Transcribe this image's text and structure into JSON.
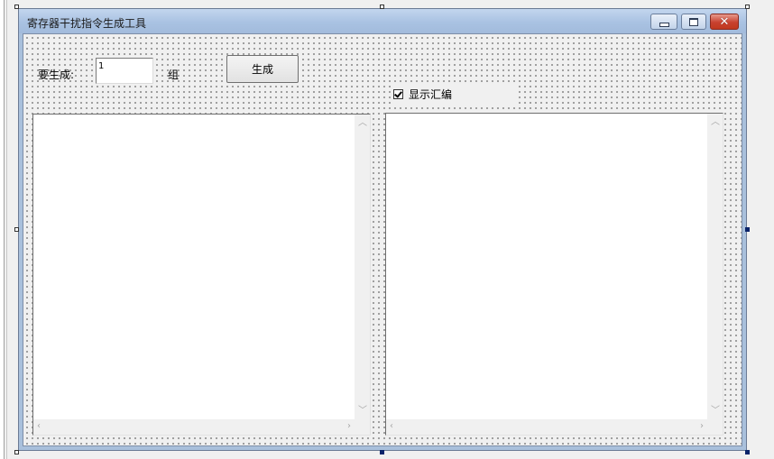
{
  "window": {
    "title": "寄存器干扰指令生成工具"
  },
  "controls": {
    "generate_label": "要生成:",
    "count_value": "1",
    "group_unit": "组",
    "generate_button": "生成",
    "show_asm_label": "显示汇编",
    "show_asm_checked": true
  },
  "icons": {
    "minimize": "minimize-icon",
    "maximize": "maximize-icon",
    "close": "close-icon",
    "scroll_up": "scroll-up-arrow-icon",
    "scroll_down": "scroll-down-arrow-icon",
    "scroll_left": "scroll-left-arrow-icon",
    "scroll_right": "scroll-right-arrow-icon",
    "checkmark": "checkmark-icon"
  },
  "colors": {
    "titlebar": "#a9c2e2",
    "close_button": "#c8412f",
    "form_background": "#f0f0f0",
    "selection_handle": "#0a246a"
  }
}
